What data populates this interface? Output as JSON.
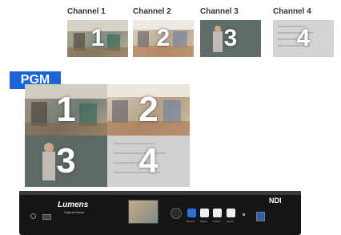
{
  "channels": [
    {
      "label": "Channel 1",
      "number": "1"
    },
    {
      "label": "Channel 2",
      "number": "2"
    },
    {
      "label": "Channel 3",
      "number": "3"
    },
    {
      "label": "Channel 4",
      "number": "4"
    }
  ],
  "pgm": {
    "badge": "PGM",
    "quads": [
      "1",
      "2",
      "3",
      "4"
    ]
  },
  "device": {
    "brand": "Lumens",
    "model": "CaptureVision",
    "ndi": "NDI",
    "buttons": [
      "Record",
      "Pause",
      "Stream",
      "Layout"
    ]
  },
  "colors": {
    "accent": "#1b63d6",
    "device_body": "#151515"
  }
}
